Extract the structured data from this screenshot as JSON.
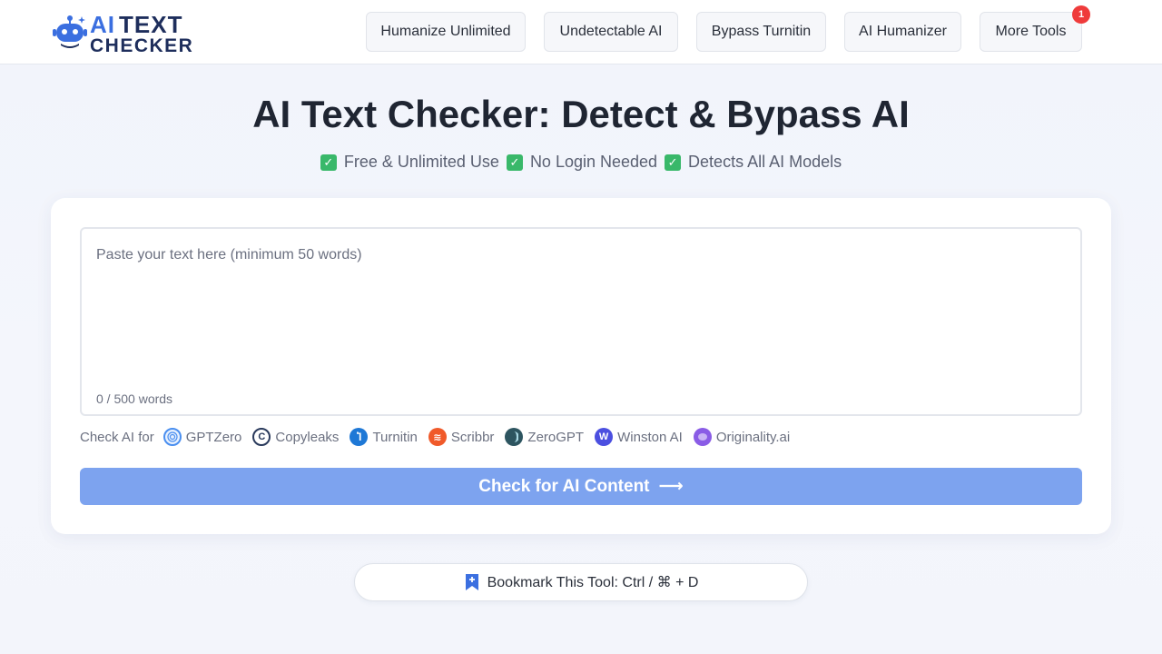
{
  "header": {
    "logo": {
      "line1_ai": "AI",
      "line1_text": "TEXT",
      "line2": "CHECKER",
      "brand_color": "#3b6fe0"
    },
    "nav": [
      {
        "label": "Humanize Unlimited"
      },
      {
        "label": "Undetectable AI"
      },
      {
        "label": "Bypass Turnitin"
      },
      {
        "label": "AI Humanizer"
      },
      {
        "label": "More Tools",
        "badge": "1"
      }
    ]
  },
  "hero": {
    "title": "AI Text Checker: Detect & Bypass AI",
    "features": [
      "Free & Unlimited Use",
      "No Login Needed",
      "Detects All AI Models"
    ]
  },
  "checker": {
    "placeholder": "Paste your text here (minimum 50 words)",
    "word_count": "0 / 500 words",
    "check_for_label": "Check AI for",
    "detectors": [
      {
        "name": "GPTZero",
        "icon": "gptzero-icon",
        "color": "#4a8ff0"
      },
      {
        "name": "Copyleaks",
        "icon": "copyleaks-icon",
        "color": "#2a3a5c"
      },
      {
        "name": "Turnitin",
        "icon": "turnitin-icon",
        "color": "#1e78d6"
      },
      {
        "name": "Scribbr",
        "icon": "scribbr-icon",
        "color": "#f05a2a"
      },
      {
        "name": "ZeroGPT",
        "icon": "zerogpt-icon",
        "color": "#2d5560"
      },
      {
        "name": "Winston AI",
        "icon": "winston-icon",
        "color": "#4b4fe0"
      },
      {
        "name": "Originality.ai",
        "icon": "originality-icon",
        "color": "#8a5ce6"
      }
    ],
    "submit_label": "Check for AI Content",
    "submit_arrow": "⟶",
    "submit_color": "#7da3ef"
  },
  "bookmark": {
    "label": "Bookmark This Tool: Ctrl / ⌘ + D"
  }
}
